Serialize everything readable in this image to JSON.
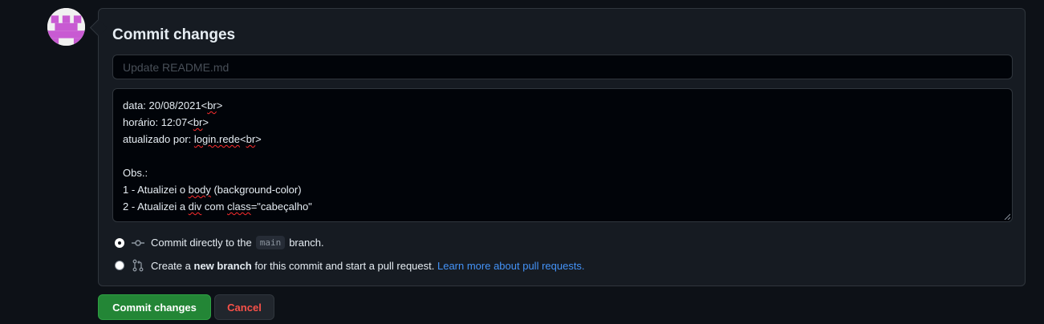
{
  "commit_form": {
    "title": "Commit changes",
    "summary": {
      "value": "",
      "placeholder": "Update README.md"
    },
    "description_lines": [
      [
        {
          "t": "data: 20/08/2021<"
        },
        {
          "t": "br",
          "sp": true
        },
        {
          "t": ">"
        }
      ],
      [
        {
          "t": "horário: 12:07<"
        },
        {
          "t": "br",
          "sp": true
        },
        {
          "t": ">"
        }
      ],
      [
        {
          "t": "atualizado por: "
        },
        {
          "t": "login.rede",
          "sp": true
        },
        {
          "t": "<"
        },
        {
          "t": "br",
          "sp": true
        },
        {
          "t": ">"
        }
      ],
      [
        {
          "t": ""
        }
      ],
      [
        {
          "t": "Obs.:"
        }
      ],
      [
        {
          "t": "1 - Atualizei o "
        },
        {
          "t": "body",
          "sp": true
        },
        {
          "t": " (background-color)"
        }
      ],
      [
        {
          "t": "2 - Atualizei a "
        },
        {
          "t": "div",
          "sp": true
        },
        {
          "t": " com "
        },
        {
          "t": "class",
          "sp": true
        },
        {
          "t": "=\"cabeçalho\""
        }
      ]
    ],
    "option_direct": {
      "selected": true,
      "icon": "git-commit-icon",
      "text_before": "Commit directly to the",
      "branch": "main",
      "text_after": "branch."
    },
    "option_new_branch": {
      "selected": false,
      "icon": "git-pull-request-icon",
      "text_before": "Create a",
      "bold": "new branch",
      "text_after": "for this commit and start a pull request.",
      "link": "Learn more about pull requests."
    }
  },
  "actions": {
    "commit_label": "Commit changes",
    "cancel_label": "Cancel"
  },
  "colors": {
    "background": "#0d1117",
    "panel": "#161b22",
    "border": "#30363d",
    "primary_button": "#238636",
    "danger_text": "#f85149",
    "link": "#4493f8",
    "avatar_pattern": "#c85ad2"
  }
}
